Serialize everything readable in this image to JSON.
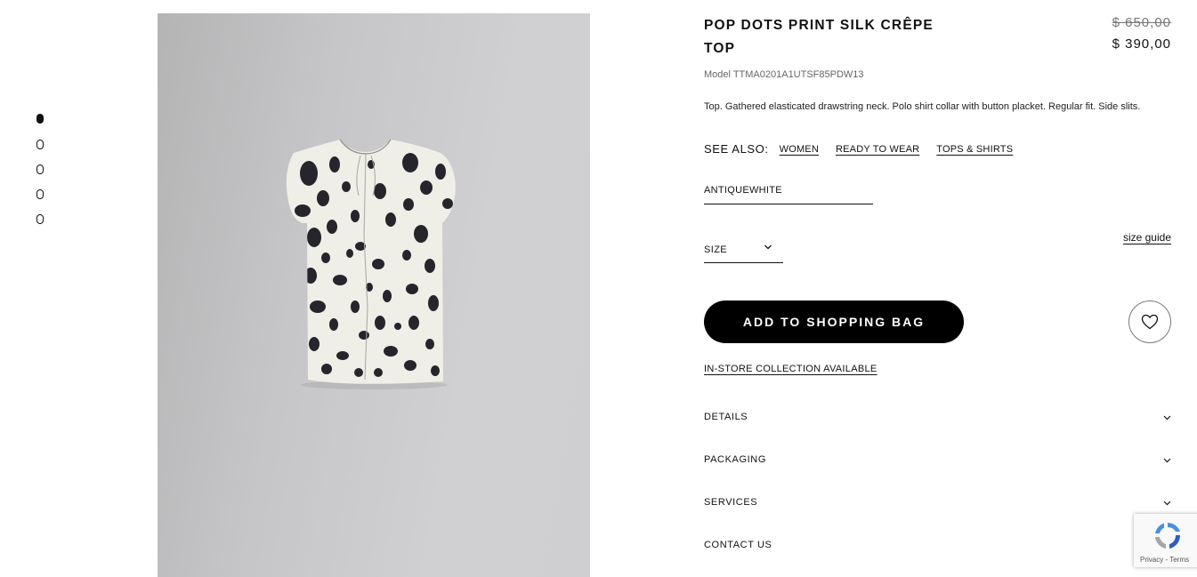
{
  "gallery": {
    "dots": [
      {
        "label": "image-1",
        "active": true
      },
      {
        "label": "image-2",
        "active": false
      },
      {
        "label": "image-3",
        "active": false
      },
      {
        "label": "image-4",
        "active": false
      },
      {
        "label": "image-5",
        "active": false
      }
    ]
  },
  "product": {
    "title_line1": "POP DOTS PRINT SILK CRÊPE",
    "title_line2": "TOP",
    "price_original": "$ 650,00",
    "price_sale": "$ 390,00",
    "model": "Model TTMA0201A1UTSF85PDW13",
    "description": "Top. Gathered elasticated drawstring neck. Polo shirt collar with button placket. Regular fit. Side slits."
  },
  "see_also": {
    "label": "SEE ALSO:",
    "links": [
      "WOMEN",
      "READY TO WEAR",
      "TOPS & SHIRTS"
    ]
  },
  "color": {
    "value": "ANTIQUEWHITE"
  },
  "size": {
    "label": "SIZE",
    "guide_label": "size guide"
  },
  "actions": {
    "add_to_bag": "ADD TO SHOPPING BAG",
    "instore": "IN-STORE COLLECTION AVAILABLE"
  },
  "accordion": [
    "DETAILS",
    "PACKAGING",
    "SERVICES",
    "CONTACT US"
  ],
  "recaptcha": {
    "privacy": "Privacy",
    "sep": " - ",
    "terms": "Terms"
  },
  "icons": {
    "wishlist": "heart-icon",
    "dropdown": "chevron-down-icon",
    "recaptcha": "recaptcha-logo-icon"
  }
}
